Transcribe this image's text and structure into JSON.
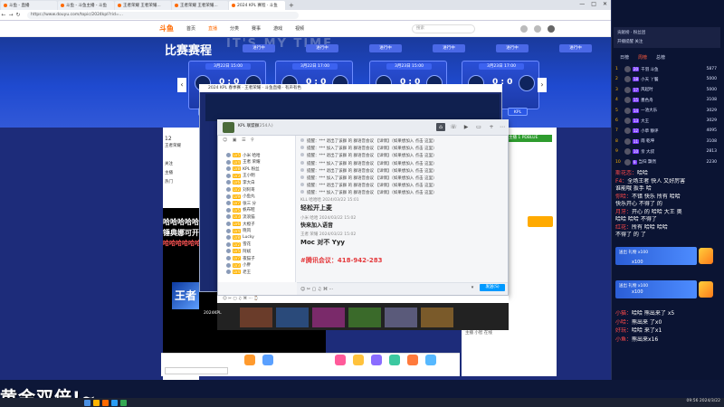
{
  "browser": {
    "tabs": [
      "斗鱼 - 直播",
      "斗鱼 - 斗鱼主播 - 斗鱼",
      "王者荣耀 王者荣耀...",
      "王者荣耀 王者荣耀...",
      "2024 KPL 赛程 · 斗鱼"
    ],
    "url": "https://www.douyu.com/topic/2024kpl?rid=...",
    "window_controls": [
      "—",
      "□",
      "✕"
    ]
  },
  "site_header": {
    "logo": "斗鱼",
    "nav": [
      "首页",
      "直播",
      "分类",
      "赛事",
      "游戏",
      "视频"
    ],
    "search_placeholder": "搜索"
  },
  "banner": {
    "bg_word": "IT'S MY TIME",
    "title": "比赛赛程",
    "timeline": [
      "进行中",
      "进行中",
      "进行中",
      "进行中",
      "进行中",
      "进行中"
    ],
    "matches": [
      {
        "time": "3月22日 15:00",
        "score": "0 : 0",
        "btn": "KPL"
      },
      {
        "time": "3月22日 17:00",
        "score": "0 : 0",
        "btn": "KPL"
      },
      {
        "time": "3月23日 15:00",
        "score": "0 : 0",
        "btn": "KPL"
      },
      {
        "time": "3月23日 17:00",
        "score": "0 : 0",
        "btn": "KPL"
      }
    ],
    "arrow_left": "‹",
    "arrow_right": "›"
  },
  "left_page": {
    "items": [
      "12",
      "王者荣耀",
      "关注",
      "主播",
      "热门"
    ],
    "video_text1": "哈哈哈哈哈哈哈",
    "video_text2": "锤典娜可开心",
    "video_text3": "哈哈哈哈哈哈",
    "video_logo": "王者"
  },
  "right_page": {
    "green_tag": "主播 1 PDBLUE",
    "rows": [
      "哈哈哈哈哈哈哈",
      "主播推荐 热门",
      "王者荣耀大神",
      "热门主播排行",
      "欢迎来到直播间",
      "热门视频 推荐",
      "主播 小智 在线"
    ]
  },
  "qq": {
    "title_name": "KPL 联盟群",
    "title_sub": "(254人)",
    "side_tools": "☺ ▣ ☰ ⚲",
    "members": [
      {
        "name": "小米 哈哈",
        "lv": "LV5"
      },
      {
        "name": "王者 荣耀",
        "lv": "LV4"
      },
      {
        "name": "KPL 粉丝",
        "lv": "LV8"
      },
      {
        "name": "王小明",
        "lv": "LV3"
      },
      {
        "name": "李大白",
        "lv": "LV6"
      },
      {
        "name": "刘阿哥",
        "lv": "LV2"
      },
      {
        "name": "小鱼丸",
        "lv": "LV9"
      },
      {
        "name": "张三 分",
        "lv": "LV7"
      },
      {
        "name": "帆布鞋",
        "lv": "LV5"
      },
      {
        "name": "流浪猫",
        "lv": "LV3"
      },
      {
        "name": "大橙子",
        "lv": "LV6"
      },
      {
        "name": "晓风",
        "lv": "LV4"
      },
      {
        "name": "Lucky",
        "lv": "LV8"
      },
      {
        "name": "雪花",
        "lv": "LV2"
      },
      {
        "name": "阿斌",
        "lv": "LV5"
      },
      {
        "name": "夜猫子",
        "lv": "LV7"
      },
      {
        "name": "小胖",
        "lv": "LV3"
      },
      {
        "name": "老王",
        "lv": "LV4"
      }
    ],
    "system_msgs": [
      "提醒：*** 退出了该群 的 群语音会议  【详情】（如果想加入 点击 这里）",
      "提醒：*** 加入了该群 的 群语音会议  【详情】（如果想加入 点击 这里）",
      "提醒：*** 退出了该群 的 群语音会议  【详情】（如果想加入 点击 这里）",
      "提醒：*** 加入了该群 的 群语音会议  【详情】（如果想加入 点击 这里）",
      "提醒：*** 退出了该群 的 群语音会议  【详情】（如果想加入 点击 这里）",
      "提醒：*** 加入了该群 的 群语音会议  【详情】（如果想加入 点击 这里）",
      "提醒：*** 退出了该群 的 群语音会议  【详情】（如果想加入 点击 这里）",
      "提醒：*** 加入了该群 的 群语音会议  【详情】（如果想加入 点击 这里）"
    ],
    "sender1": "KLL 哈哈哈  2024/03/22 15:01",
    "msg1": "轻松开上麦",
    "sender2": "小米 哈哈  2024/03/22 15:02",
    "msg2": "快来加入语音",
    "sender3": "王者 荣耀  2024/03/22 15:02",
    "msg3": "Moc 对不 Yyy",
    "msg4": "#腾讯会议：418-942-283",
    "input_tools": "☺ ✂ ▢ ♫ ⌘ ⋯",
    "send": "发送(S)",
    "send_menu": "▾",
    "lower_strip": "☺ ✂ ▢ ♫ ⌘ ⋯  ⌚"
  },
  "back_window": {
    "title": "2024 KPL 春季赛 · 王者荣耀 · 斗鱼直播 · 有声有色"
  },
  "thumb_label": "2024KPL",
  "sidebar": {
    "top_lines": [
      "贡献榜 · 粉丝团",
      "开播提醒  关注"
    ],
    "tabs": [
      "日榜",
      "周榜",
      "总榜"
    ],
    "rank": [
      {
        "num": "1",
        "badge": "20",
        "name": "千羽 斗鱼",
        "val": "5877"
      },
      {
        "num": "2",
        "badge": "18",
        "name": "小天 丫鬟",
        "val": "5000"
      },
      {
        "num": "3",
        "badge": "17",
        "name": "风起时",
        "val": "5000"
      },
      {
        "num": "4",
        "badge": "15",
        "name": "墨色舟",
        "val": "3108"
      },
      {
        "num": "5",
        "badge": "14",
        "name": "一池大乐",
        "val": "3029"
      },
      {
        "num": "6",
        "badge": "13",
        "name": "大王",
        "val": "3029"
      },
      {
        "num": "7",
        "badge": "12",
        "name": "小草 静评",
        "val": "4095"
      },
      {
        "num": "8",
        "badge": "11",
        "name": "雨 乾坤",
        "val": "3108"
      },
      {
        "num": "9",
        "badge": "10",
        "name": "亲 大叔",
        "val": "2813"
      },
      {
        "num": "10",
        "badge": "9",
        "name": "当归 飘然",
        "val": "2230"
      }
    ],
    "chat": [
      {
        "u": "斯花恋：",
        "t": "哈哈"
      },
      {
        "u": "F4：",
        "t": "全场王者 快人 又好厉害"
      },
      {
        "u": "",
        "t": "谁能哦 扳手 哈"
      },
      {
        "u": "你哈：",
        "t": "不错 快乐 所有 哈哈"
      },
      {
        "u": "",
        "t": "快乐开心 不得了 的"
      },
      {
        "u": "月牙：",
        "t": "开心 的 哈哈 大王 奥"
      },
      {
        "u": "",
        "t": "哈哈 哈哈 不得了"
      },
      {
        "u": "红花：",
        "t": "所有 哈哈 哈哈"
      },
      {
        "u": "",
        "t": "不得了 的 了"
      }
    ],
    "gift_texts": [
      "送出 礼物 x100",
      "送出 礼物 x100"
    ],
    "counts": [
      "x100",
      "x100"
    ],
    "bottom_chat": [
      {
        "u": "小猫：",
        "t": "哈哈 熊出来了 x5"
      },
      {
        "u": "小哈：",
        "t": "熊出来 了x0"
      },
      {
        "u": "好玩：",
        "t": "哈哈 来了x1"
      },
      {
        "u": "小鱼：",
        "t": "熊出来x16"
      }
    ]
  },
  "overlay_text": "黄金双倍!~",
  "tray": "09:56 2024/3/22"
}
